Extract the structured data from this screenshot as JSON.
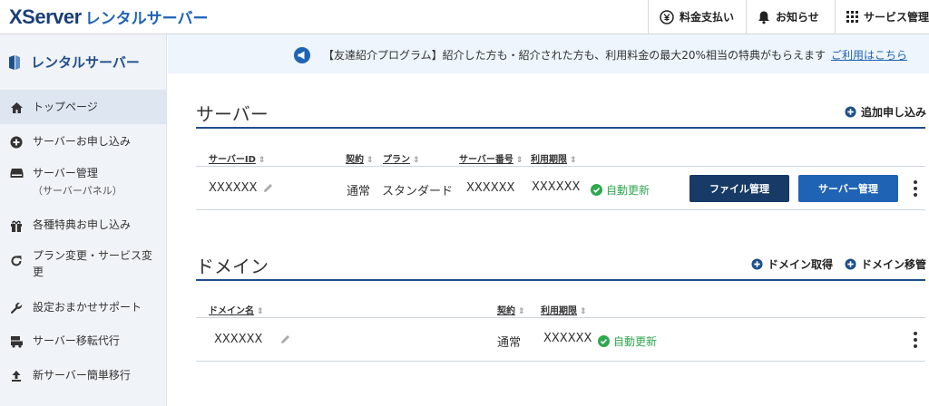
{
  "header": {
    "logo_brand": "XServer",
    "logo_product": "レンタルサーバー",
    "nav": [
      {
        "label": "料金支払い",
        "icon": "yen-icon"
      },
      {
        "label": "お知らせ",
        "icon": "bell-icon"
      },
      {
        "label": "サービス管理",
        "icon": "grid-icon"
      }
    ]
  },
  "sidebar": {
    "title": "レンタルサーバー",
    "items": [
      {
        "label": "トップページ",
        "icon": "home-icon",
        "active": true
      },
      {
        "label": "サーバーお申し込み",
        "icon": "plus-circle-icon"
      },
      {
        "label": "サーバー管理",
        "sub": "（サーバーパネル）",
        "icon": "server-icon"
      },
      {
        "label": "各種特典お申し込み",
        "icon": "gift-icon"
      },
      {
        "label": "プラン変更・サービス変更",
        "icon": "refresh-icon"
      },
      {
        "label": "設定おまかせサポート",
        "icon": "wrench-icon"
      },
      {
        "label": "サーバー移転代行",
        "icon": "truck-icon"
      },
      {
        "label": "新サーバー簡単移行",
        "icon": "upload-icon"
      }
    ]
  },
  "banner": {
    "text": "【友達紹介プログラム】紹介した方も・紹介された方も、利用料金の最大20%相当の特典がもらえます",
    "link": "ご利用はこちら"
  },
  "server_section": {
    "title": "サーバー",
    "action": "追加申し込み",
    "columns": [
      "サーバーID",
      "契約",
      "プラン",
      "サーバー番号",
      "利用期限"
    ],
    "row": {
      "server_id": "XXXXXX",
      "contract": "通常",
      "plan": "スタンダード",
      "server_number": "XXXXXX",
      "expiry": "XXXXXX",
      "status": "自動更新",
      "file_button": "ファイル管理",
      "server_button": "サーバー管理"
    }
  },
  "domain_section": {
    "title": "ドメイン",
    "actions": [
      "ドメイン取得",
      "ドメイン移管"
    ],
    "columns": [
      "ドメイン名",
      "契約",
      "利用期限"
    ],
    "row": {
      "domain": "XXXXXX",
      "contract": "通常",
      "expiry": "XXXXXX",
      "status": "自動更新"
    }
  },
  "colors": {
    "brand": "#1a3f78",
    "accent": "#1f63b4",
    "dark_button": "#173a66",
    "status_green": "#2fa84f"
  }
}
